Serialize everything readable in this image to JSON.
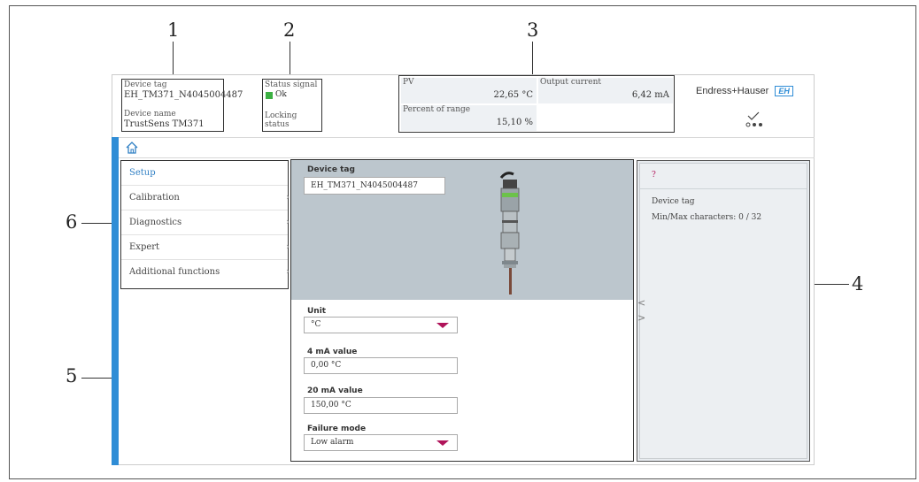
{
  "callouts": [
    "1",
    "2",
    "3",
    "4",
    "5",
    "6"
  ],
  "header": {
    "device_tag_label": "Device tag",
    "device_tag_value": "EH_TM371_N4045004487",
    "device_name_label": "Device name",
    "device_name_value": "TrustSens TM371",
    "status_signal_label": "Status signal",
    "status_value": "Ok",
    "locking_status_label": "Locking status",
    "pv_label": "PV",
    "pv_value": "22,65 °C",
    "output_current_label": "Output current",
    "output_current_value": "6,42 mA",
    "percent_label": "Percent of range",
    "percent_value": "15,10 %",
    "brand": "Endress+Hauser",
    "brand_badge": "EH",
    "colors": {
      "accent_blue": "#2f8dd6",
      "status_green": "#3cb043",
      "dropdown_magenta": "#b0145a"
    }
  },
  "nav": {
    "home_icon": "home-icon"
  },
  "menu": {
    "items": [
      {
        "label": "Setup",
        "active": true
      },
      {
        "label": "Calibration",
        "chevron": "›"
      },
      {
        "label": "Diagnostics",
        "chevron": "›"
      },
      {
        "label": "Expert",
        "chevron": "›"
      },
      {
        "label": "Additional functions",
        "chevron": "›"
      }
    ]
  },
  "content": {
    "device_tag_label": "Device tag",
    "device_tag_value": "EH_TM371_N4045004487",
    "unit_label": "Unit",
    "unit_value": "°C",
    "ma4_label": "4 mA value",
    "ma4_value": "0,00 °C",
    "ma20_label": "20 mA value",
    "ma20_value": "150,00 °C",
    "failure_label": "Failure mode",
    "failure_value": "Low alarm"
  },
  "help": {
    "question": "?",
    "title": "Device tag",
    "detail": "Min/Max characters: 0 / 32",
    "prev": "<",
    "next": ">"
  }
}
